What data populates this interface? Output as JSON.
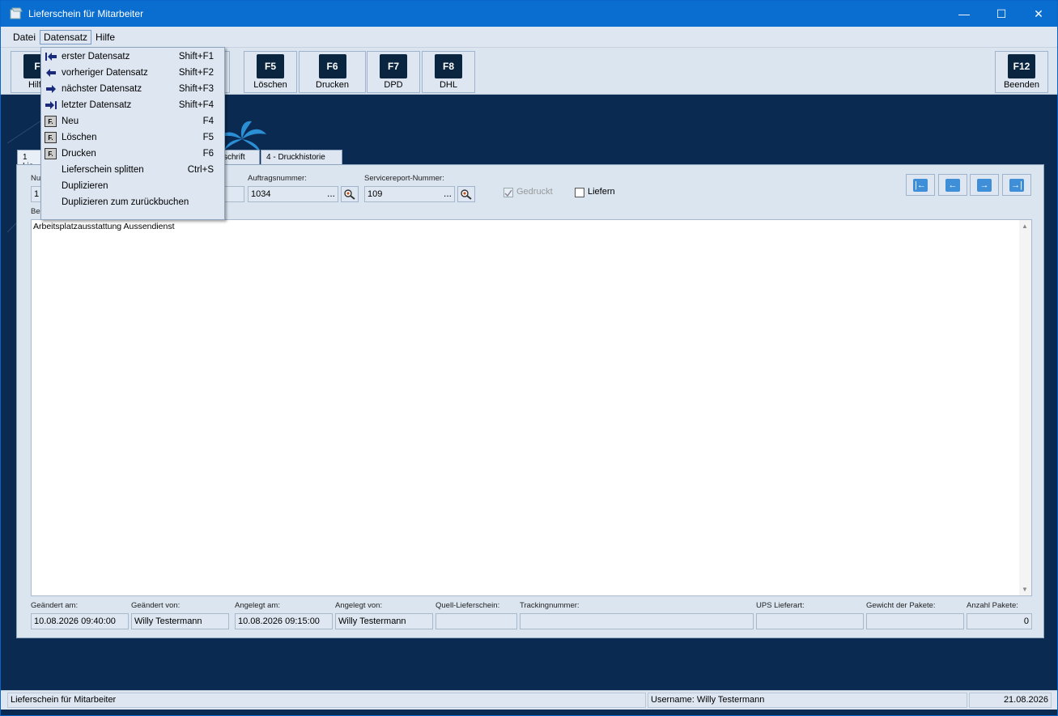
{
  "window": {
    "title": "Lieferschein für Mitarbeiter"
  },
  "menubar": {
    "items": [
      "Datei",
      "Datensatz",
      "Hilfe"
    ]
  },
  "toolbar": {
    "buttons": [
      {
        "key": "F",
        "label": "Hilfe"
      },
      {
        "key": "F5",
        "label": "Löschen"
      },
      {
        "key": "F6",
        "label": "Drucken"
      },
      {
        "key": "F7",
        "label": "DPD"
      },
      {
        "key": "F8",
        "label": "DHL"
      },
      {
        "key": "F12",
        "label": "Beenden"
      }
    ]
  },
  "dropdown": {
    "items": [
      {
        "label": "erster Datensatz",
        "shortcut": "Shift+F1",
        "icon": "first-record-icon"
      },
      {
        "label": "vorheriger Datensatz",
        "shortcut": "Shift+F2",
        "icon": "previous-record-icon"
      },
      {
        "label": "nächster Datensatz",
        "shortcut": "Shift+F3",
        "icon": "next-record-icon"
      },
      {
        "label": "letzter Datensatz",
        "shortcut": "Shift+F4",
        "icon": "last-record-icon"
      },
      {
        "label": "Neu",
        "shortcut": "F4",
        "icon": "f-key-icon"
      },
      {
        "label": "Löschen",
        "shortcut": "F5",
        "icon": "f-key-icon"
      },
      {
        "label": "Drucken",
        "shortcut": "F6",
        "icon": "f-key-icon"
      },
      {
        "label": "Lieferschein splitten",
        "shortcut": "Ctrl+S",
        "icon": ""
      },
      {
        "label": "Duplizieren",
        "shortcut": "",
        "icon": ""
      },
      {
        "label": "Duplizieren zum zurückbuchen",
        "shortcut": "",
        "icon": ""
      }
    ]
  },
  "tabs": [
    {
      "label": "1 Lie"
    },
    {
      "label": "schrift"
    },
    {
      "label": "4 - Druckhistorie"
    }
  ],
  "form": {
    "nummer_label": "Nu",
    "nummer_value": "1",
    "auftrag_label": "Auftragsnummer:",
    "auftrag_value": "1034",
    "service_label": "Servicereport-Nummer:",
    "service_value": "109",
    "gedruckt_label": "Gedruckt",
    "liefern_label": "Liefern",
    "bemerkung_label": "Be",
    "bemerkung_text": "Arbeitsplatzausstattung Aussendienst",
    "lookup_dots": "...",
    "footer": {
      "geaendert_am_label": "Geändert am:",
      "geaendert_am_value": "10.08.2026 09:40:00",
      "geaendert_von_label": "Geändert von:",
      "geaendert_von_value": "Willy Testermann",
      "angelegt_am_label": "Angelegt am:",
      "angelegt_am_value": "10.08.2026 09:15:00",
      "angelegt_von_label": "Angelegt von:",
      "angelegt_von_value": "Willy Testermann",
      "quell_label": "Quell-Lieferschein:",
      "quell_value": "",
      "tracking_label": "Trackingnummer:",
      "tracking_value": "",
      "ups_label": "UPS Lieferart:",
      "ups_value": "",
      "gewicht_label": "Gewicht der Pakete:",
      "gewicht_value": "",
      "anzahl_label": "Anzahl Pakete:",
      "anzahl_value": "0"
    }
  },
  "statusbar": {
    "left": "Lieferschein für Mitarbeiter",
    "user": "Username: Willy Testermann",
    "date": "21.08.2026"
  },
  "colors": {
    "titlebar": "#0a6ed1",
    "background": "#0b2a52",
    "panel": "#dbe5f0",
    "accent_icon": "#3f8fd8"
  }
}
